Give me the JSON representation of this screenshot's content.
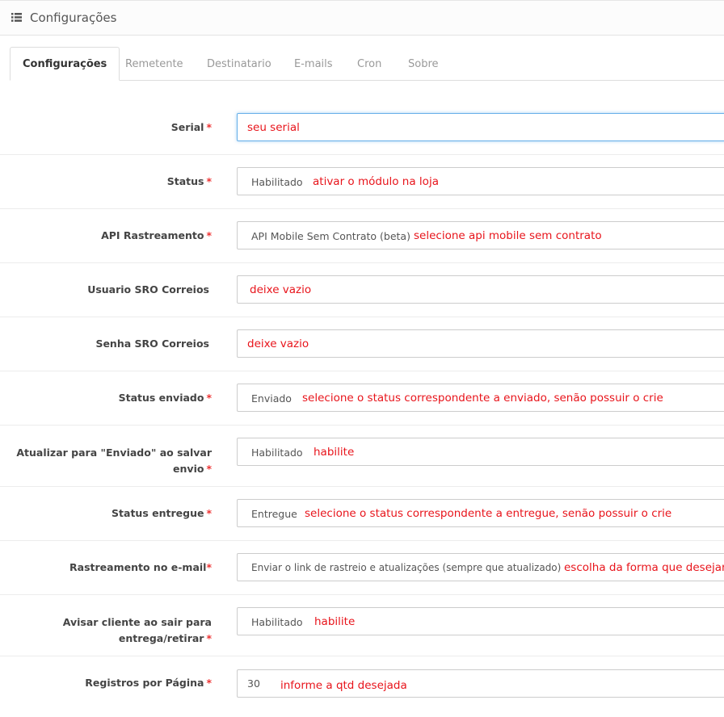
{
  "panel": {
    "title": "Configurações",
    "icon": "list-icon"
  },
  "tabs": [
    "Configurações",
    "Remetente",
    "Destinatario",
    "E-mails",
    "Cron",
    "Sobre"
  ],
  "rows": [
    {
      "label": "Serial",
      "required": "*",
      "value": "",
      "note": "seu serial"
    },
    {
      "label": "Status",
      "required": "*",
      "value": "Habilitado",
      "note": "ativar o módulo na loja"
    },
    {
      "label": "API Rastreamento",
      "required": "*",
      "value": "API Mobile Sem Contrato (beta)",
      "note": "selecione api mobile sem contrato"
    },
    {
      "label": "Usuario SRO Correios",
      "required": "",
      "value": "",
      "note": "deixe vazio"
    },
    {
      "label": "Senha SRO Correios",
      "required": "",
      "value": "",
      "note": "deixe vazio"
    },
    {
      "label": "Status enviado",
      "required": "*",
      "value": "Enviado",
      "note": "selecione o status correspondente a enviado, senão possuir o crie"
    },
    {
      "label_line1": "Atualizar para \"Enviado\" ao salvar",
      "label_line2": "envio",
      "required": "*",
      "value": "Habilitado",
      "note": "habilite"
    },
    {
      "label": "Status entregue",
      "required": "*",
      "value": "Entregue",
      "note": "selecione o status correspondente a entregue, senão possuir o crie"
    },
    {
      "label": "Rastreamento no e-mail",
      "required": "*",
      "value": "Enviar o link de rastreio e atualizações (sempre que atualizado)",
      "note": "escolha da forma que desejar"
    },
    {
      "label_line1": "Avisar cliente ao sair para",
      "label_line2": "entrega/retirar",
      "required": "*",
      "value": "Habilitado",
      "note": "habilite"
    },
    {
      "label": "Registros por Página",
      "required": "*",
      "value": "30",
      "note": "informe a qtd desejada"
    }
  ]
}
